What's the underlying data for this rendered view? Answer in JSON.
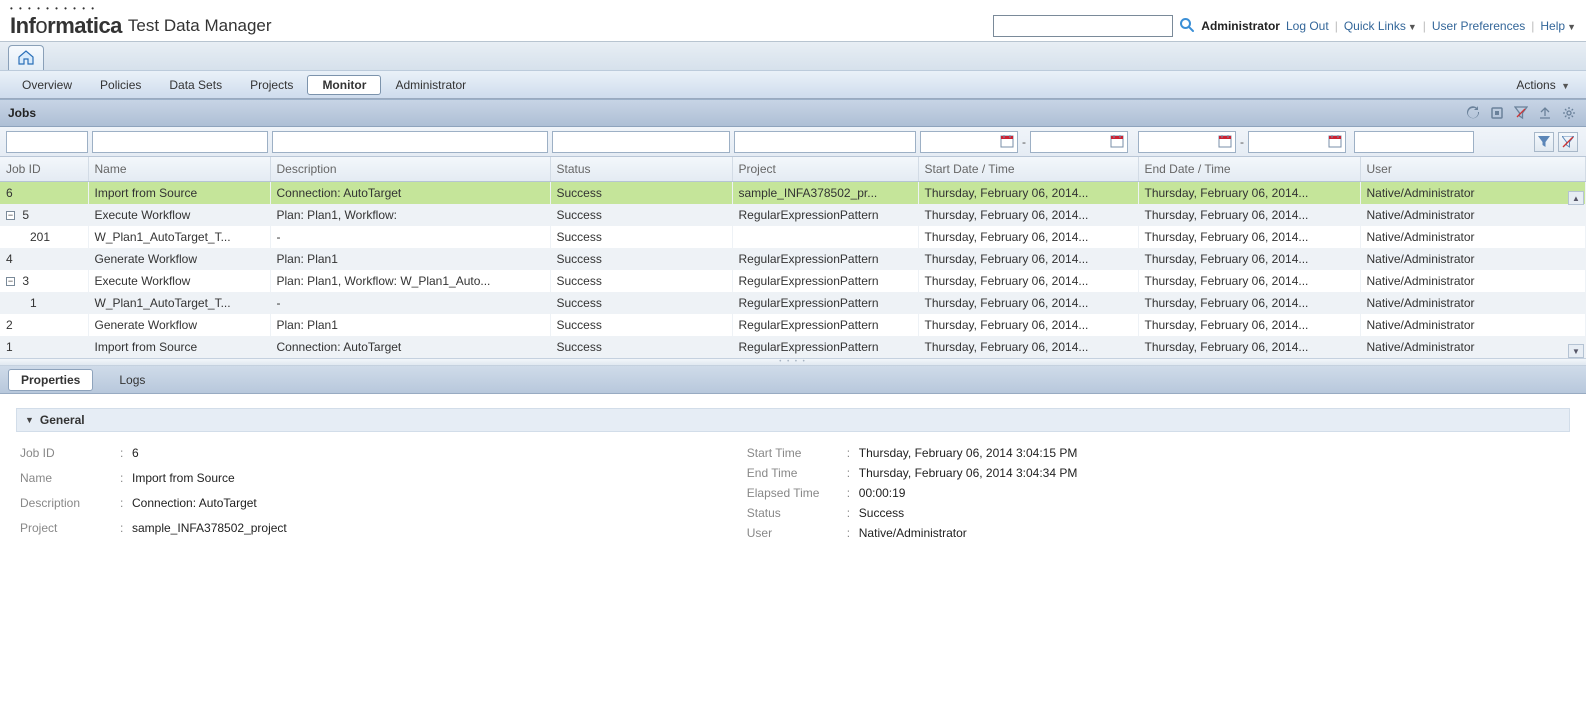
{
  "header": {
    "brand": "Informatica",
    "app_title": "Test Data Manager",
    "search_value": "",
    "user": "Administrator",
    "logout": "Log Out",
    "quick_links": "Quick Links",
    "user_prefs": "User Preferences",
    "help": "Help"
  },
  "nav": {
    "overview": "Overview",
    "policies": "Policies",
    "datasets": "Data Sets",
    "projects": "Projects",
    "monitor": "Monitor",
    "administrator": "Administrator",
    "actions": "Actions"
  },
  "jobs": {
    "title": "Jobs",
    "columns": {
      "jobid": "Job ID",
      "name": "Name",
      "description": "Description",
      "status": "Status",
      "project": "Project",
      "start": "Start Date / Time",
      "end": "End Date / Time",
      "user": "User"
    },
    "rows": [
      {
        "jobid": "6",
        "name": "Import from Source",
        "description": "Connection: AutoTarget",
        "status": "Success",
        "project": "sample_INFA378502_pr...",
        "start": "Thursday, February 06, 2014...",
        "end": "Thursday, February 06, 2014...",
        "user": "Native/Administrator",
        "selected": true
      },
      {
        "jobid": "5",
        "name": "Execute Workflow",
        "description": "Plan: Plan1, Workflow:",
        "status": "Success",
        "project": "RegularExpressionPattern",
        "start": "Thursday, February 06, 2014...",
        "end": "Thursday, February 06, 2014...",
        "user": "Native/Administrator",
        "expandable": true,
        "expanded": true
      },
      {
        "jobid": "201",
        "name": "W_Plan1_AutoTarget_T...",
        "description": "-",
        "status": "Success",
        "project": "",
        "start": "Thursday, February 06, 2014...",
        "end": "Thursday, February 06, 2014...",
        "user": "Native/Administrator",
        "child": true
      },
      {
        "jobid": "4",
        "name": "Generate Workflow",
        "description": "Plan: Plan1",
        "status": "Success",
        "project": "RegularExpressionPattern",
        "start": "Thursday, February 06, 2014...",
        "end": "Thursday, February 06, 2014...",
        "user": "Native/Administrator"
      },
      {
        "jobid": "3",
        "name": "Execute Workflow",
        "description": "Plan: Plan1, Workflow: W_Plan1_Auto...",
        "status": "Success",
        "project": "RegularExpressionPattern",
        "start": "Thursday, February 06, 2014...",
        "end": "Thursday, February 06, 2014...",
        "user": "Native/Administrator",
        "expandable": true,
        "expanded": true
      },
      {
        "jobid": "1",
        "name": "W_Plan1_AutoTarget_T...",
        "description": "-",
        "status": "Success",
        "project": "RegularExpressionPattern",
        "start": "Thursday, February 06, 2014...",
        "end": "Thursday, February 06, 2014...",
        "user": "Native/Administrator",
        "child": true
      },
      {
        "jobid": "2",
        "name": "Generate Workflow",
        "description": "Plan: Plan1",
        "status": "Success",
        "project": "RegularExpressionPattern",
        "start": "Thursday, February 06, 2014...",
        "end": "Thursday, February 06, 2014...",
        "user": "Native/Administrator"
      },
      {
        "jobid": "1",
        "name": "Import from Source",
        "description": "Connection: AutoTarget",
        "status": "Success",
        "project": "RegularExpressionPattern",
        "start": "Thursday, February 06, 2014...",
        "end": "Thursday, February 06, 2014...",
        "user": "Native/Administrator"
      }
    ]
  },
  "details": {
    "tab_properties": "Properties",
    "tab_logs": "Logs",
    "section_general": "General",
    "left": {
      "jobid_label": "Job ID",
      "jobid_value": "6",
      "name_label": "Name",
      "name_value": "Import from Source",
      "desc_label": "Description",
      "desc_value": "Connection: AutoTarget",
      "project_label": "Project",
      "project_value": "sample_INFA378502_project"
    },
    "right": {
      "start_label": "Start Time",
      "start_value": "Thursday, February 06, 2014 3:04:15 PM",
      "end_label": "End Time",
      "end_value": "Thursday, February 06, 2014 3:04:34 PM",
      "elapsed_label": "Elapsed Time",
      "elapsed_value": "00:00:19",
      "status_label": "Status",
      "status_value": "Success",
      "user_label": "User",
      "user_value": "Native/Administrator"
    }
  }
}
